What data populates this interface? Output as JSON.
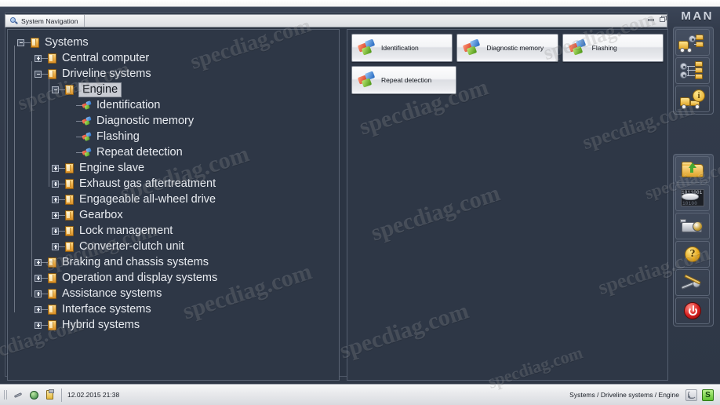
{
  "window": {
    "brand": "MAN",
    "minimize_label": "Minimize",
    "restore_label": "Restore"
  },
  "tab": {
    "label": "System Navigation",
    "icon": "magnifier-icon"
  },
  "tree": {
    "nodes": [
      {
        "label": "Systems",
        "depth": 0,
        "toggle": "minus",
        "icon": "ecu-icon",
        "selected": false
      },
      {
        "label": "Central computer",
        "depth": 1,
        "toggle": "plus",
        "icon": "ecu-icon",
        "selected": false
      },
      {
        "label": "Driveline systems",
        "depth": 1,
        "toggle": "minus",
        "icon": "ecu-icon",
        "selected": false
      },
      {
        "label": "Engine",
        "depth": 2,
        "toggle": "minus",
        "icon": "ecu-icon",
        "selected": true
      },
      {
        "label": "Identification",
        "depth": 3,
        "toggle": "none",
        "icon": "puzzle-icon",
        "selected": false
      },
      {
        "label": "Diagnostic memory",
        "depth": 3,
        "toggle": "none",
        "icon": "puzzle-icon",
        "selected": false
      },
      {
        "label": "Flashing",
        "depth": 3,
        "toggle": "none",
        "icon": "puzzle-icon",
        "selected": false
      },
      {
        "label": "Repeat detection",
        "depth": 3,
        "toggle": "none",
        "icon": "puzzle-icon",
        "selected": false
      },
      {
        "label": "Engine slave",
        "depth": 2,
        "toggle": "plus",
        "icon": "ecu-icon",
        "selected": false
      },
      {
        "label": "Exhaust gas aftertreatment",
        "depth": 2,
        "toggle": "plus",
        "icon": "ecu-icon",
        "selected": false
      },
      {
        "label": "Engageable all-wheel drive",
        "depth": 2,
        "toggle": "plus",
        "icon": "ecu-icon",
        "selected": false
      },
      {
        "label": "Gearbox",
        "depth": 2,
        "toggle": "plus",
        "icon": "ecu-icon",
        "selected": false
      },
      {
        "label": "Lock management",
        "depth": 2,
        "toggle": "plus",
        "icon": "ecu-icon",
        "selected": false
      },
      {
        "label": "Converter-clutch unit",
        "depth": 2,
        "toggle": "plus",
        "icon": "ecu-icon",
        "selected": false
      },
      {
        "label": "Braking and chassis systems",
        "depth": 1,
        "toggle": "plus",
        "icon": "ecu-icon",
        "selected": false
      },
      {
        "label": "Operation and display systems",
        "depth": 1,
        "toggle": "plus",
        "icon": "ecu-icon",
        "selected": false
      },
      {
        "label": "Assistance systems",
        "depth": 1,
        "toggle": "plus",
        "icon": "ecu-icon",
        "selected": false
      },
      {
        "label": "Interface systems",
        "depth": 1,
        "toggle": "plus",
        "icon": "ecu-icon",
        "selected": false
      },
      {
        "label": "Hybrid systems",
        "depth": 1,
        "toggle": "plus",
        "icon": "ecu-icon",
        "selected": false
      }
    ]
  },
  "content": {
    "buttons": [
      {
        "label": "Identification",
        "icon": "puzzle-icon"
      },
      {
        "label": "Diagnostic memory",
        "icon": "puzzle-icon"
      },
      {
        "label": "Flashing",
        "icon": "puzzle-icon"
      },
      {
        "label": "Repeat detection",
        "icon": "puzzle-icon"
      }
    ]
  },
  "toolbar": {
    "top_group": [
      {
        "name": "truck-systems-icon",
        "tooltip": "Vehicle systems"
      },
      {
        "name": "network-folders-icon",
        "tooltip": "System groups"
      },
      {
        "name": "truck-info-icon",
        "tooltip": "Vehicle information",
        "badge": "i"
      }
    ],
    "bottom_group": [
      {
        "name": "folder-upload-icon",
        "tooltip": "Open / import"
      },
      {
        "name": "binary-data-icon",
        "tooltip": "Data",
        "line1": "1011001",
        "line2": "10100"
      },
      {
        "name": "camera-icon",
        "tooltip": "Screenshot"
      },
      {
        "name": "help-icon",
        "tooltip": "Help",
        "glyph": "?"
      },
      {
        "name": "tools-icon",
        "tooltip": "Settings"
      },
      {
        "name": "power-icon",
        "tooltip": "Exit"
      }
    ]
  },
  "statusbar": {
    "timestamp": "12.02.2015 21:38",
    "path": "Systems / Driveline systems / Engine",
    "icons": [
      "wrench-icon",
      "globe-icon",
      "clipboard-icon",
      "rss-icon",
      "s-badge-icon"
    ],
    "badge_letter": "S"
  },
  "watermark": {
    "text": "specdiag.com"
  },
  "colors": {
    "panel_bg": "#2e3746",
    "frame_bg": "#333c4c",
    "accent_orange": "#e0a72a",
    "accent_green": "#4d9a17",
    "accent_red": "#d51f1f",
    "selection_bg": "#c8cbd2"
  }
}
